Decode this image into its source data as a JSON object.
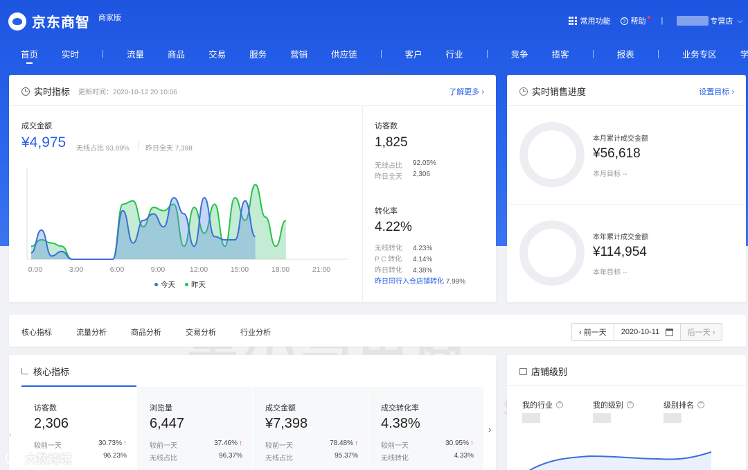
{
  "header": {
    "brand": "京东商智",
    "edition": "商家版",
    "common_functions": "常用功能",
    "help": "帮助",
    "divider": "|",
    "store_suffix": "专营店"
  },
  "nav": [
    "首页",
    "实时",
    "流量",
    "商品",
    "交易",
    "服务",
    "营销",
    "供应链",
    "客户",
    "行业",
    "竞争",
    "揽客",
    "报表",
    "业务专区",
    "学院"
  ],
  "realtime": {
    "title": "实时指标",
    "update_time": "更新时间：2020-10-12 20:10:06",
    "more_link": "了解更多 ›",
    "gmv_label": "成交金额",
    "gmv_value": "¥4,975",
    "wireless_share": "无线占比 93.89%",
    "yesterday_total": "昨日全天 7,398",
    "visitors_label": "访客数",
    "visitors_value": "1,825",
    "visitors_wireless": "无线占比",
    "visitors_wireless_val": "92.05%",
    "visitors_yesterday": "昨日全天",
    "visitors_yesterday_val": "2,306",
    "conv_label": "转化率",
    "conv_value": "4.22%",
    "conv_rows": [
      {
        "label": "无线转化",
        "value": "4.23%"
      },
      {
        "label": "P C 转化",
        "value": "4.14%"
      },
      {
        "label": "昨日转化",
        "value": "4.38%"
      }
    ],
    "peer_link": "昨日同行入仓店铺转化",
    "peer_value": "7.99%"
  },
  "sales": {
    "title": "实时销售进度",
    "set_target": "设置目标 ›",
    "month_label": "本月累计成交金额",
    "month_value": "¥56,618",
    "month_target": "本月目标 --",
    "year_label": "本年累计成交金额",
    "year_value": "¥114,954",
    "year_target": "本年目标 --"
  },
  "analysis_tabs": [
    "核心指标",
    "流量分析",
    "商品分析",
    "交易分析",
    "行业分析"
  ],
  "date_picker": {
    "prev": "‹ 前一天",
    "date": "2020-10-11",
    "next": "后一天 ›"
  },
  "core": {
    "title": "核心指标",
    "metrics": [
      {
        "label": "访客数",
        "value": "2,306",
        "cmp_label": "较前一天",
        "cmp": "30.73%",
        "sub_label": "",
        "sub": "96.23%"
      },
      {
        "label": "浏览量",
        "value": "6,447",
        "cmp_label": "较前一天",
        "cmp": "37.46%",
        "sub_label": "无线占比",
        "sub": "96.37%"
      },
      {
        "label": "成交金额",
        "value": "¥7,398",
        "cmp_label": "较前一天",
        "cmp": "78.48%",
        "sub_label": "无线占比",
        "sub": "95.37%"
      },
      {
        "label": "成交转化率",
        "value": "4.38%",
        "cmp_label": "较前一天",
        "cmp": "30.95%",
        "sub_label": "无线转化",
        "sub": "4.33%"
      }
    ]
  },
  "store_level": {
    "title": "店铺级别",
    "labels": [
      "我的行业",
      "我的级别",
      "级别排名"
    ]
  },
  "watermark": {
    "cn": "黑小马电商",
    "en": "HEI XIAO MA DIAN SHANG",
    "corner": "大数跨境"
  },
  "chart_data": {
    "type": "area",
    "x": [
      "0:00",
      "3:00",
      "6:00",
      "9:00",
      "12:00",
      "15:00",
      "18:00",
      "21:00"
    ],
    "legend": [
      "今天",
      "昨天"
    ],
    "series": [
      {
        "name": "今天",
        "color": "#3a6fd8",
        "values": [
          10,
          45,
          5,
          12,
          0,
          0,
          0,
          0,
          0,
          75,
          25,
          60,
          70,
          50,
          95,
          70,
          20,
          95,
          35,
          30,
          30,
          90,
          35,
          0,
          0,
          0,
          0,
          0,
          0,
          0,
          0,
          0
        ]
      },
      {
        "name": "昨天",
        "color": "#27c24c",
        "values": [
          20,
          30,
          25,
          20,
          0,
          0,
          0,
          0,
          0,
          85,
          90,
          50,
          80,
          75,
          85,
          20,
          80,
          40,
          85,
          20,
          95,
          60,
          115,
          65,
          20,
          60,
          0,
          0,
          0,
          0,
          0,
          0
        ]
      }
    ],
    "ylim": [
      0,
      140
    ]
  }
}
